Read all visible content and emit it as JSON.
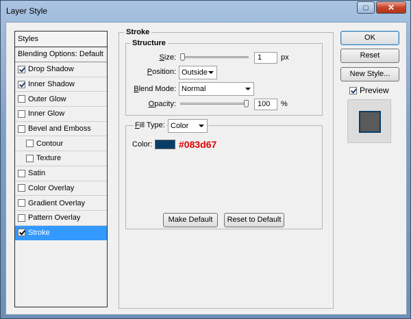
{
  "window": {
    "title": "Layer Style"
  },
  "styles_list": {
    "header": "Styles",
    "blending": "Blending Options: Default",
    "items": [
      {
        "label": "Drop Shadow",
        "checked": true,
        "indent": false,
        "selected": false
      },
      {
        "label": "Inner Shadow",
        "checked": true,
        "indent": false,
        "selected": false
      },
      {
        "label": "Outer Glow",
        "checked": false,
        "indent": false,
        "selected": false
      },
      {
        "label": "Inner Glow",
        "checked": false,
        "indent": false,
        "selected": false
      },
      {
        "label": "Bevel and Emboss",
        "checked": false,
        "indent": false,
        "selected": false
      },
      {
        "label": "Contour",
        "checked": false,
        "indent": true,
        "selected": false
      },
      {
        "label": "Texture",
        "checked": false,
        "indent": true,
        "selected": false
      },
      {
        "label": "Satin",
        "checked": false,
        "indent": false,
        "selected": false
      },
      {
        "label": "Color Overlay",
        "checked": false,
        "indent": false,
        "selected": false
      },
      {
        "label": "Gradient Overlay",
        "checked": false,
        "indent": false,
        "selected": false
      },
      {
        "label": "Pattern Overlay",
        "checked": false,
        "indent": false,
        "selected": false
      },
      {
        "label": "Stroke",
        "checked": true,
        "indent": false,
        "selected": true
      }
    ]
  },
  "stroke": {
    "title": "Stroke",
    "structure_title": "Structure",
    "size": {
      "label": "Size:",
      "value": "1",
      "unit": "px",
      "slider_fraction": 0.0
    },
    "position": {
      "label": "Position:",
      "value": "Outside"
    },
    "blend_mode": {
      "label": "Blend Mode:",
      "value": "Normal"
    },
    "opacity": {
      "label": "Opacity:",
      "value": "100",
      "unit": "%",
      "slider_fraction": 1.0
    },
    "fill_type": {
      "label": "Fill Type:",
      "value": "Color"
    },
    "color": {
      "label": "Color:",
      "hex_label": "#083d67",
      "swatch": "#083d67"
    },
    "make_default": "Make Default",
    "reset_default": "Reset to Default"
  },
  "right": {
    "ok": "OK",
    "reset": "Reset",
    "new_style": "New Style...",
    "preview": {
      "label": "Preview",
      "checked": true
    }
  },
  "colors": {
    "selection": "#3399ff",
    "accent_hex": "#e00000"
  }
}
